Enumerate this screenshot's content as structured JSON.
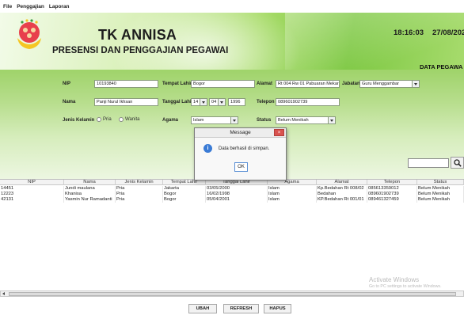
{
  "menu": [
    "File",
    "Penggajian",
    "Laporan"
  ],
  "header": {
    "title": "TK ANNISA",
    "subtitle": "PRESENSI DAN PENGGAJIAN PEGAWAI",
    "clock": "18:16:03",
    "date": "27/08/202",
    "section": "DATA PEGAWA"
  },
  "form": {
    "nip_label": "NIP",
    "nip_value": "10193840",
    "nama_label": "Nama",
    "nama_value": "Panji Nurul Ikhsan",
    "jk_label": "Jenis Kelamin",
    "jk_pria": "Pria",
    "jk_wanita": "Wanita",
    "tempat_label": "Tempat Lahir",
    "tempat_value": "Bogor",
    "tanggal_label": "Tanggal Lahir",
    "tanggal_day": "14",
    "tanggal_month": "04",
    "tanggal_year": "1996",
    "agama_label": "Agama",
    "agama_value": "Islam",
    "alamat_label": "Alamat",
    "alamat_value": "Rt 004 Rw 01 Pabuaran Mekar",
    "telepon_label": "Telepon",
    "telepon_value": "089601902739",
    "status_label": "Status",
    "status_value": "Belum Menikah",
    "jabatan_label": "Jabatan",
    "jabatan_value": "Guru Menggambar"
  },
  "table": {
    "columns": [
      "NIP",
      "Nama",
      "Jenis Kelamin",
      "Tempat Lahir",
      "Tanggal Lahir",
      "Agama",
      "Alamat",
      "Telepon",
      "Status"
    ],
    "rows": [
      [
        "14451",
        "Jundi maulana",
        "Pria",
        "Jakarta",
        "03/05/2000",
        "Islam",
        "Kp.Bedahan Rt 008/02",
        "085613359012",
        "Belum Menikah"
      ],
      [
        "12223",
        "Khanisa",
        "Pria",
        "Bogor",
        "16/02/1998",
        "Islam",
        "Bedahan",
        "089601902739",
        "Belum Menikah"
      ],
      [
        "42131",
        "Yasmin Nur Ramadanti",
        "Pria",
        "Bogor",
        "05/04/2001",
        "Islam",
        "KP.Bedahan Rt 001/01",
        "089461327459",
        "Belum Menikah"
      ]
    ]
  },
  "buttons": {
    "ubah": "UBAH",
    "refresh": "REFRESH",
    "hapus": "HAPUS"
  },
  "dialog": {
    "title": "Message",
    "message": "Data berhasil di simpan.",
    "ok": "OK"
  },
  "watermark": {
    "line1": "Activate Windows",
    "line2": "Go to PC settings to activate Windows."
  },
  "icons": {
    "logo": "school-logo-icon",
    "search": "search-icon",
    "info": "info-icon",
    "close": "close-icon"
  }
}
